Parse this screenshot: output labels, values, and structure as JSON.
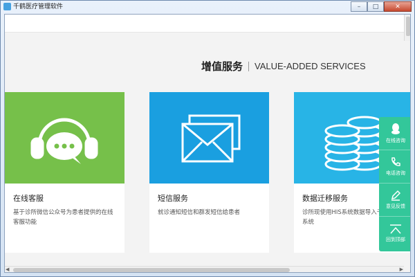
{
  "window": {
    "title": "千鹤医疗管理软件",
    "controls": {
      "minimize": "–",
      "maximize": "□",
      "close": "✕"
    }
  },
  "section": {
    "title_cn": "增值服务",
    "title_en": "VALUE-ADDED SERVICES"
  },
  "cards": [
    {
      "name": "在线客服",
      "desc": "基于诊所微信公众号为患者提供的在线客服功能",
      "icon": "headset-chat-icon",
      "color": "#76c04a"
    },
    {
      "name": "短信服务",
      "desc": "就诊通知短信和群发短信给患者",
      "icon": "envelopes-icon",
      "color": "#1a9fe0"
    },
    {
      "name": "数据迁移服务",
      "desc": "诊所现使用HIS系统数据导入千鹤医疗系统",
      "icon": "database-coins-icon",
      "color": "#28b4e6"
    }
  ],
  "floatbar": {
    "color": "#33c79a",
    "items": [
      {
        "label": "在线咨询",
        "icon": "qq-penguin-icon"
      },
      {
        "label": "电话咨询",
        "icon": "phone-icon"
      },
      {
        "label": "意见反馈",
        "icon": "pencil-icon"
      },
      {
        "label": "回到顶部",
        "icon": "back-to-top-icon"
      }
    ]
  }
}
